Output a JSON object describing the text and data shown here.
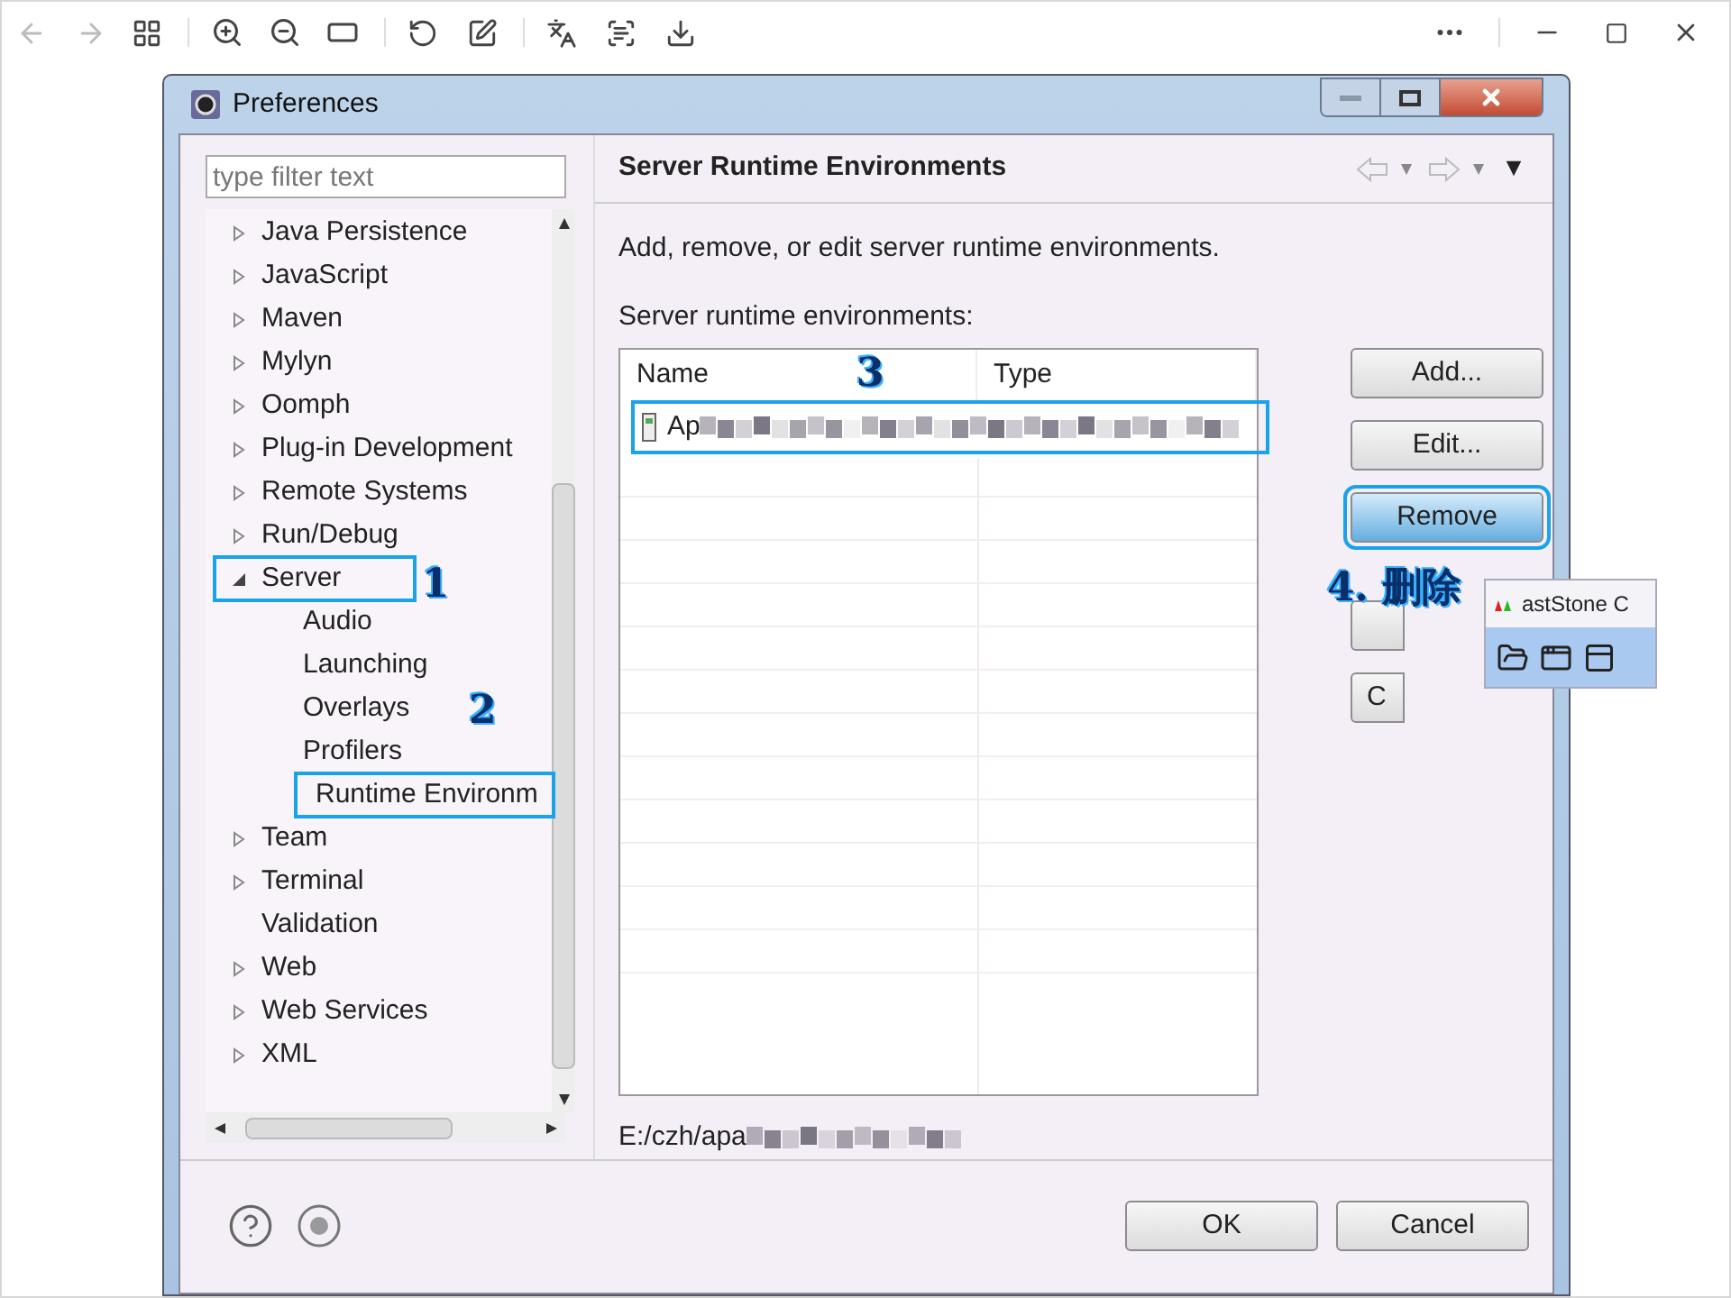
{
  "dialog": {
    "title": "Preferences",
    "filter": {
      "placeholder": "type filter text"
    },
    "tree": [
      {
        "label": "Java Persistence",
        "kind": "folder",
        "expanded": false,
        "highlighted": false
      },
      {
        "label": "JavaScript",
        "kind": "folder",
        "expanded": false,
        "highlighted": false
      },
      {
        "label": "Maven",
        "kind": "folder",
        "expanded": false,
        "highlighted": false
      },
      {
        "label": "Mylyn",
        "kind": "folder",
        "expanded": false,
        "highlighted": false
      },
      {
        "label": "Oomph",
        "kind": "folder",
        "expanded": false,
        "highlighted": false
      },
      {
        "label": "Plug-in Development",
        "kind": "folder",
        "expanded": false,
        "highlighted": false
      },
      {
        "label": "Remote Systems",
        "kind": "folder",
        "expanded": false,
        "highlighted": false
      },
      {
        "label": "Run/Debug",
        "kind": "folder",
        "expanded": false,
        "highlighted": false
      },
      {
        "label": "Server",
        "kind": "folder",
        "expanded": true,
        "highlighted": true,
        "annotation": "1",
        "children": [
          {
            "label": "Audio",
            "kind": "leaf",
            "highlighted": false
          },
          {
            "label": "Launching",
            "kind": "leaf",
            "highlighted": false
          },
          {
            "label": "Overlays",
            "kind": "leaf",
            "highlighted": false
          },
          {
            "label": "Profilers",
            "kind": "leaf",
            "highlighted": false
          },
          {
            "label": "Runtime Environm",
            "kind": "leaf",
            "highlighted": true,
            "annotation": "2"
          }
        ]
      },
      {
        "label": "Team",
        "kind": "folder",
        "expanded": false,
        "highlighted": false
      },
      {
        "label": "Terminal",
        "kind": "folder",
        "expanded": false,
        "highlighted": false
      },
      {
        "label": "Validation",
        "kind": "leaf",
        "highlighted": false
      },
      {
        "label": "Web",
        "kind": "folder",
        "expanded": false,
        "highlighted": false
      },
      {
        "label": "Web Services",
        "kind": "folder",
        "expanded": false,
        "highlighted": false
      },
      {
        "label": "XML",
        "kind": "folder",
        "expanded": false,
        "highlighted": false
      }
    ],
    "page": {
      "title": "Server Runtime Environments",
      "description": "Add, remove, or edit server runtime environments.",
      "list_label": "Server runtime environments:",
      "table": {
        "columns": [
          "Name",
          "Type"
        ],
        "rows": [
          {
            "name": "Ap",
            "highlighted": true,
            "annotation": "3"
          }
        ]
      },
      "buttons": [
        {
          "label": "Add...",
          "highlighted": false
        },
        {
          "label": "Edit...",
          "highlighted": false
        },
        {
          "label": "Remove",
          "highlighted": true,
          "annotation": "4. 删除"
        }
      ],
      "covered_button": "C",
      "path": "E:/czh/apa"
    },
    "footer_buttons": [
      "OK",
      "Cancel"
    ],
    "popup": {
      "title": "astStone C"
    }
  }
}
